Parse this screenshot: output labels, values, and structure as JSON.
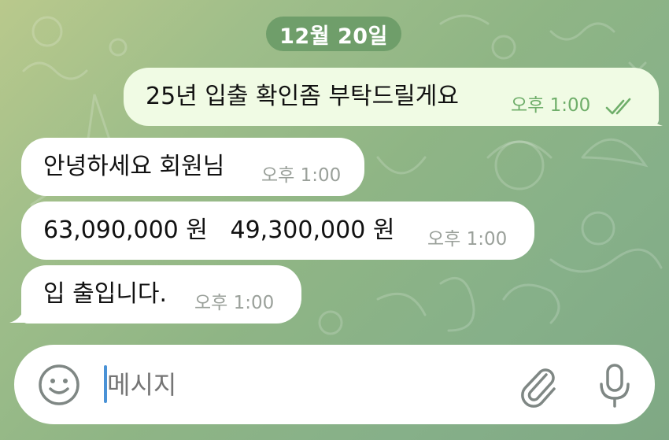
{
  "date_label": "12월 20일",
  "messages": [
    {
      "direction": "out",
      "text": "25년 입출 확인좀 부탁드릴게요",
      "time": "오후 1:00",
      "status": "read-double-check"
    },
    {
      "direction": "in",
      "text": "안녕하세요 회원님",
      "time": "오후 1:00"
    },
    {
      "direction": "in",
      "text": "63,090,000 원   49,300,000 원",
      "time": "오후 1:00"
    },
    {
      "direction": "in",
      "text": "입 출입니다.",
      "time": "오후 1:00"
    }
  ],
  "composer": {
    "placeholder": "메시지",
    "emoji_icon": "smiley-icon",
    "attach_icon": "paperclip-icon",
    "voice_icon": "microphone-icon"
  },
  "colors": {
    "date_pill": "#6f9e6a",
    "outgoing_bubble": "#f0fbe4",
    "incoming_bubble": "#ffffff",
    "outgoing_meta": "#6fae6a",
    "caret": "#4a92d6"
  }
}
